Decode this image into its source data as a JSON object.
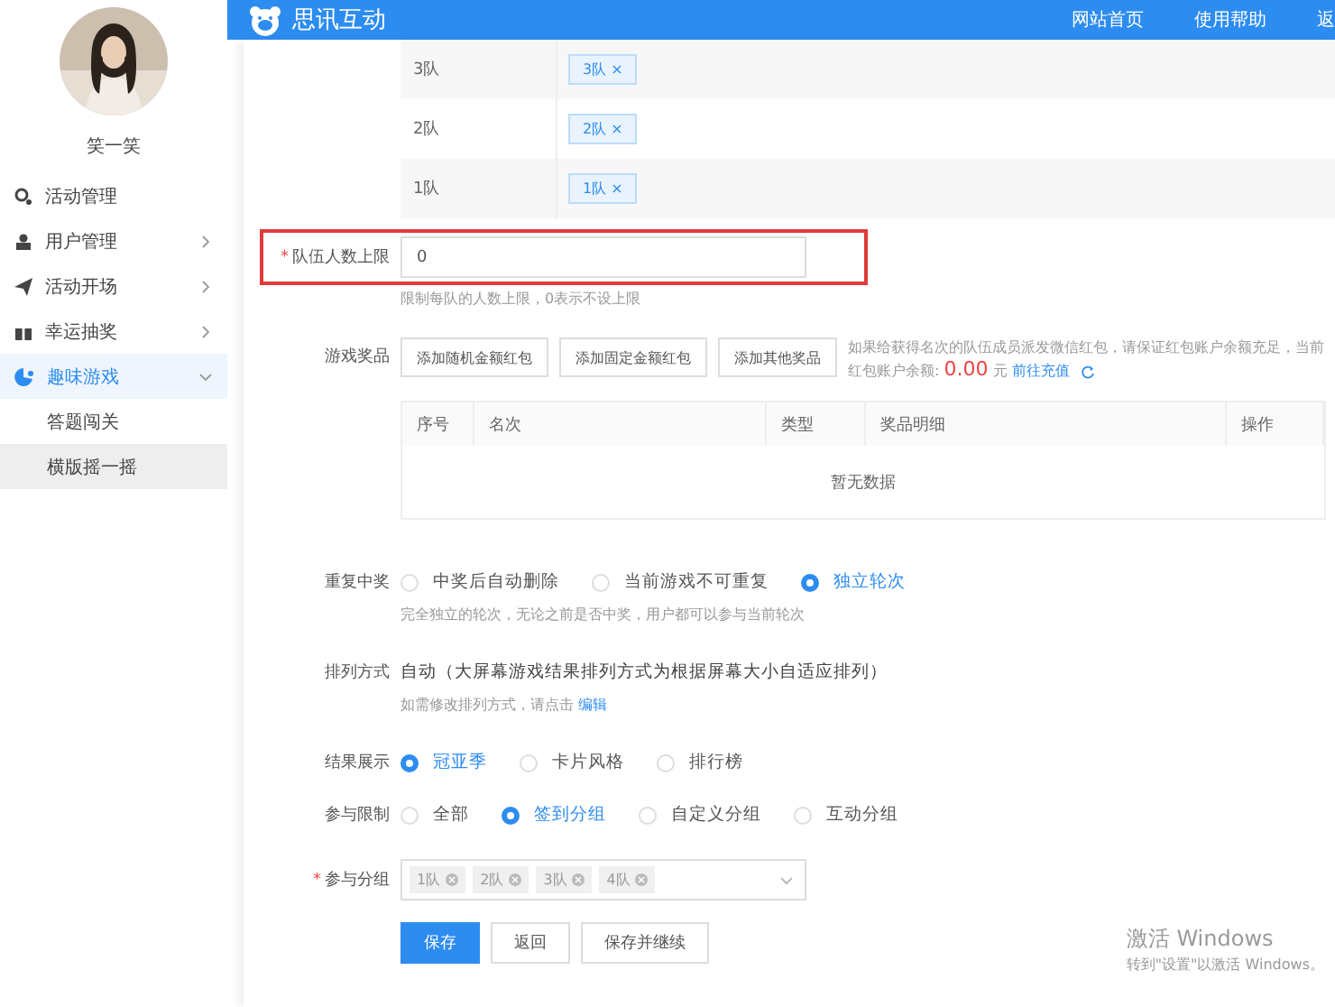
{
  "sidebar": {
    "user_name": "笑一笑",
    "items": [
      {
        "label": "活动管理",
        "selected": false,
        "has_arrow": false
      },
      {
        "label": "用户管理",
        "expanded": false,
        "selected": false,
        "has_arrow": true
      },
      {
        "label": "活动开场",
        "expanded": false,
        "selected": false,
        "has_arrow": true
      },
      {
        "label": "幸运抽奖",
        "expanded": false,
        "selected": false,
        "has_arrow": true
      },
      {
        "label": "趣味游戏",
        "expanded": true,
        "selected": true,
        "has_arrow": true,
        "children": [
          {
            "label": "答题闯关",
            "selected": false
          },
          {
            "label": "横版摇一摇",
            "selected": true
          }
        ]
      }
    ]
  },
  "header": {
    "brand": "思讯互动",
    "links": [
      "网站首页",
      "使用帮助",
      "返"
    ]
  },
  "teams": [
    {
      "name": "3队",
      "tag": "3队",
      "close": "×"
    },
    {
      "name": "2队",
      "tag": "2队",
      "close": "×"
    },
    {
      "name": "1队",
      "tag": "1队",
      "close": "×"
    }
  ],
  "team_limit": {
    "required_mark": "*",
    "label": "队伍人数上限",
    "value": "0",
    "hint": "限制每队的人数上限，0表示不设上限"
  },
  "prizes": {
    "label": "游戏奖品",
    "buttons": [
      "添加随机金额红包",
      "添加固定金额红包",
      "添加其他奖品"
    ],
    "note": "如果给获得名次的队伍成员派发微信红包，请保证红包账户余额充足，当前红包账户余额:",
    "amount": "0.00",
    "unit": "元",
    "recharge_link": "前往充值",
    "table": {
      "columns": [
        "序号",
        "名次",
        "类型",
        "奖品明细",
        "操作"
      ],
      "empty": "暂无数据"
    }
  },
  "radio_groups": [
    {
      "label": "重复中奖",
      "options": [
        {
          "label": "中奖后自动删除",
          "selected": false
        },
        {
          "label": "当前游戏不可重复",
          "selected": false
        },
        {
          "label": "独立轮次",
          "selected": true
        }
      ],
      "hint": "完全独立的轮次，无论之前是否中奖，用户都可以参与当前轮次"
    },
    {
      "label": "排列方式",
      "kind": "text",
      "value": "自动（大屏幕游戏结果排列方式为根据屏幕大小自适应排列）",
      "hint": "如需修改排列方式，请点击",
      "hint_link": "编辑"
    },
    {
      "label": "结果展示",
      "options": [
        {
          "label": "冠亚季",
          "selected": true
        },
        {
          "label": "卡片风格",
          "selected": false
        },
        {
          "label": "排行榜",
          "selected": false
        }
      ]
    },
    {
      "label": "参与限制",
      "options": [
        {
          "label": "全部",
          "selected": false
        },
        {
          "label": "签到分组",
          "selected": true
        },
        {
          "label": "自定义分组",
          "selected": false
        },
        {
          "label": "互动分组",
          "selected": false
        }
      ]
    }
  ],
  "groups": {
    "required_mark": "*",
    "label": "参与分组",
    "tags": [
      "1队",
      "2队",
      "3队",
      "4队"
    ]
  },
  "actions": [
    {
      "label": "保存",
      "primary": true
    },
    {
      "label": "返回",
      "primary": false
    },
    {
      "label": "保存并继续",
      "primary": false
    }
  ],
  "os_notice": {
    "title": "激活 Windows",
    "text": "转到\"设置\"以激活 Windows。"
  }
}
